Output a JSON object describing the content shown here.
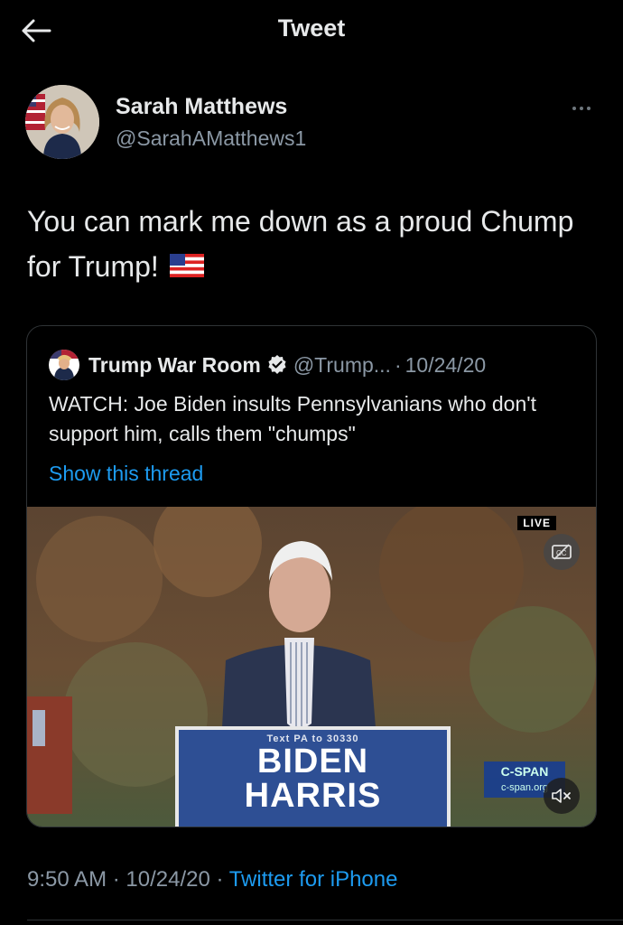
{
  "header": {
    "title": "Tweet",
    "back_icon": "arrow-left-icon"
  },
  "author": {
    "name": "Sarah Matthews",
    "handle": "@SarahAMatthews1"
  },
  "tweet": {
    "text": "You can mark me down as a proud Chump for Trump!",
    "emoji": "us-flag"
  },
  "quote": {
    "name": "Trump War Room",
    "handle": "@Trump...",
    "separator": "·",
    "date": "10/24/20",
    "text": "WATCH: Joe Biden insults Pennsylvanians who don't support him, calls them \"chumps\"",
    "link": "Show this thread",
    "media": {
      "live_label": "LIVE",
      "sign_small": "Text PA to 30330",
      "sign_line1": "BIDEN",
      "sign_line2": "HARRIS",
      "network": "C-SPAN",
      "network_site": "c-span.org"
    }
  },
  "meta": {
    "time": "9:50 AM",
    "sep1": " · ",
    "date": "10/24/20",
    "sep2": " · ",
    "source": "Twitter for iPhone"
  },
  "colors": {
    "background": "#000000",
    "link": "#1d9bf0",
    "secondary": "#8b98a5",
    "verified": "#e7e9ea"
  }
}
